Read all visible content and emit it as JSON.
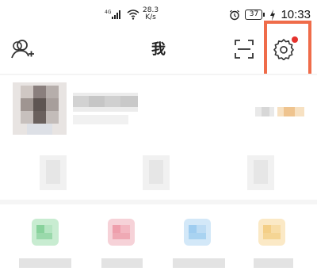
{
  "status_bar": {
    "network_speed_value": "28.3",
    "network_speed_unit": "K/s",
    "battery": "37",
    "time": "10:33",
    "icons": [
      "signal-4g-icon",
      "wifi-icon",
      "alarm-icon",
      "charging-icon"
    ]
  },
  "header": {
    "title": "我",
    "left_icon": "add-friend-icon",
    "scan_icon": "scan-icon",
    "settings_icon": "settings-icon",
    "notification_dot_color": "#e5322d",
    "highlight_color": "#ef6c4a"
  }
}
